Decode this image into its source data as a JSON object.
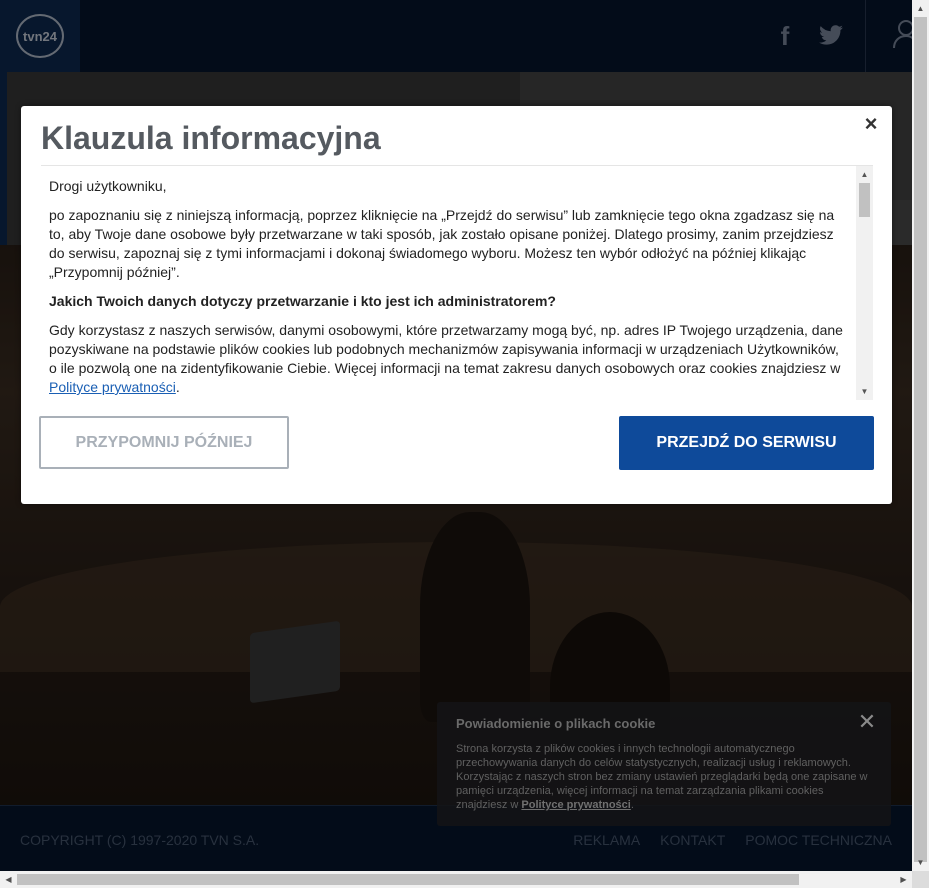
{
  "header": {
    "logo_text": "tvn24",
    "social": {
      "facebook_glyph": "f"
    }
  },
  "modal": {
    "title": "Klauzula informacyjna",
    "close_glyph": "×",
    "paragraphs": {
      "greeting": "Drogi użytkowniku,",
      "intro": "po zapoznaniu się z niniejszą informacją, poprzez kliknięcie na „Przejdź do serwisu” lub zamknięcie tego okna zgadzasz się na to, aby Twoje dane osobowe były przetwarzane w taki sposób, jak zostało opisane poniżej. Dlatego prosimy, zanim przejdziesz do serwisu, zapoznaj się z tymi informacjami i dokonaj świadomego wyboru. Możesz ten wybór odłożyć na później klikając „Przypomnij później”.",
      "heading": "Jakich Twoich danych dotyczy przetwarzanie i kto jest ich administratorem?",
      "data_text": "Gdy korzystasz z naszych serwisów, danymi osobowymi, które przetwarzamy mogą być, np. adres IP Twojego urządzenia, dane pozyskiwane na podstawie plików cookies lub podobnych mechanizmów zapisywania informacji w urządzeniach Użytkowników, o ile pozwolą one na zidentyfikowanie Ciebie. Więcej informacji na temat zakresu danych osobowych oraz cookies znajdziesz w ",
      "privacy_link": "Polityce prywatności",
      "data_text_end": "."
    },
    "buttons": {
      "later": "PRZYPOMNIJ PÓŹNIEJ",
      "go": "PRZEJDŹ DO SERWISU"
    }
  },
  "cookie_notice": {
    "title": "Powiadomienie o plikach cookie",
    "close_glyph": "✕",
    "text": "Strona korzysta z plików cookies i innych technologii automatycznego przechowywania danych do celów statystycznych, realizacji usług i reklamowych. Korzystając z naszych stron bez zmiany ustawień przeglądarki będą one zapisane w pamięci urządzenia, więcej informacji na temat zarządzania plikami cookies znajdziesz w ",
    "link": "Polityce prywatności",
    "text_end": "."
  },
  "footer": {
    "copyright": "COPYRIGHT (C) 1997-2020 TVN S.A.",
    "links": [
      "REKLAMA",
      "KONTAKT",
      "POMOC TECHNICZNA"
    ]
  },
  "scrollbars": {
    "up": "▲",
    "down": "▼",
    "left": "◀",
    "right": "▶"
  },
  "colors": {
    "brand_blue": "#0e4a9a",
    "header_bg": "#06172f",
    "link": "#1a5fb4"
  }
}
